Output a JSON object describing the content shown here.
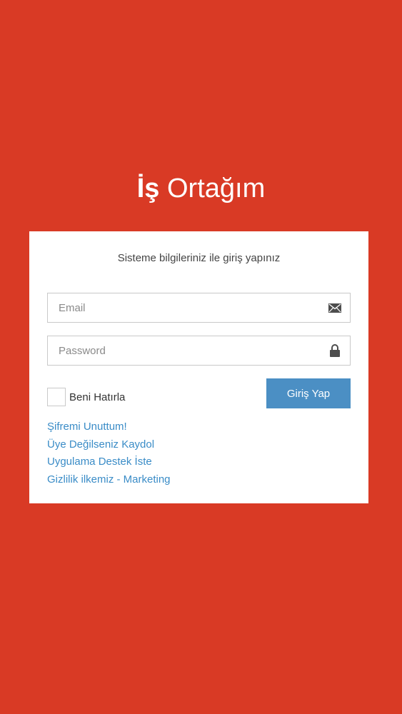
{
  "brand": {
    "bold": "İş",
    "light": "Ortağım"
  },
  "login": {
    "subtitle": "Sisteme bilgileriniz ile giriş yapınız",
    "email_placeholder": "Email",
    "password_placeholder": "Password",
    "remember_label": "Beni Hatırla",
    "submit_label": "Giriş Yap"
  },
  "links": [
    "Şifremi Unuttum!",
    "Üye Değilseniz Kaydol",
    "Uygulama Destek İste",
    "Gizlilik ilkemiz - Marketing"
  ],
  "icons": {
    "email": "envelope-icon",
    "password": "lock-icon"
  },
  "colors": {
    "background": "#d93a25",
    "card": "#ffffff",
    "button": "#4b8fc4",
    "link": "#3a8cc7"
  }
}
